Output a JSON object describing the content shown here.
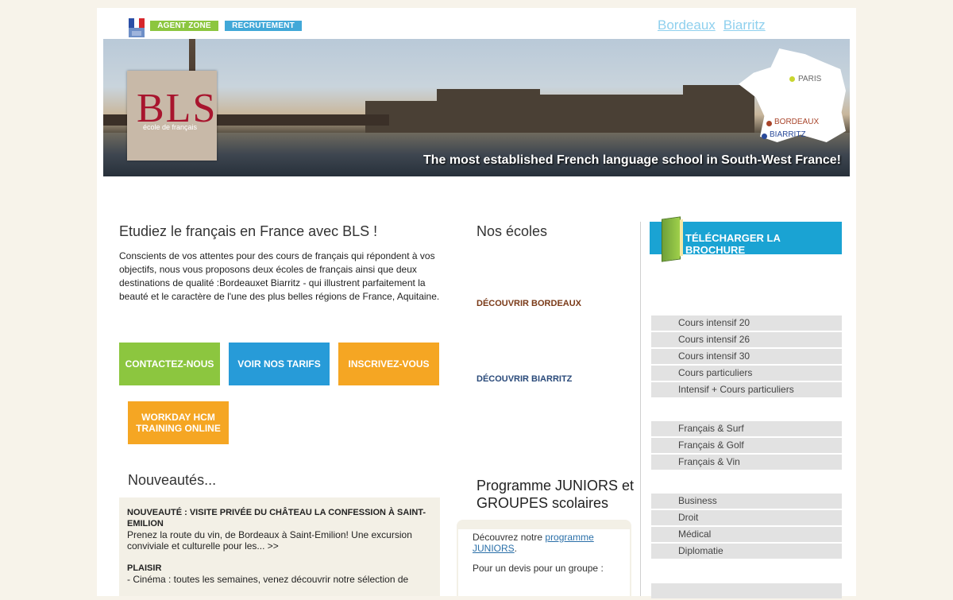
{
  "topbar": {
    "agent_zone": "AGENT ZONE",
    "recrutement": "RECRUTEMENT",
    "city_links": [
      "Bordeaux",
      "Biarritz"
    ]
  },
  "banner": {
    "logo_mark": "BLS",
    "logo_sub": "école de français",
    "map_cities": [
      "PARIS",
      "BORDEAUX",
      "BIARRITZ"
    ],
    "tagline": "The most established French language school in South-West France!"
  },
  "intro": {
    "title": "Etudiez le français en France avec BLS !",
    "text": "Conscients de vos attentes pour des cours de français qui répondent à vos objectifs, nous vous proposons deux écoles de français ainsi que deux destinations de qualité :Bordeauxet Biarritz - qui illustrent parfaitement la beauté et le caractère de l'une des plus belles régions de France, Aquitaine."
  },
  "cta": {
    "contact": "CONTACTEZ-NOUS",
    "tarifs": "VOIR NOS TARIFS",
    "inscrivez": "INSCRIVEZ-VOUS",
    "workday": "WORKDAY HCM TRAINING ONLINE"
  },
  "news": {
    "heading": "Nouveautés...",
    "item_title": "NOUVEAUTÉ : VISITE PRIVÉE DU CHÂTEAU LA CONFESSION À SAINT-EMILION",
    "item_text": "Prenez la route du vin, de Bordeaux à Saint-Emilion! Une excursion conviviale et culturelle pour les... >>",
    "plaisir_title": "PLAISIR",
    "plaisir_text": "- Cinéma : toutes les semaines, venez découvrir notre sélection de"
  },
  "schools": {
    "heading": "Nos écoles",
    "bordeaux": "DÉCOUVRIR BORDEAUX",
    "biarritz": "DÉCOUVRIR BIARRITZ"
  },
  "juniors": {
    "heading": "Programme JUNIORS et GROUPES scolaires",
    "text_before": "Découvrez notre ",
    "link": "programme JUNIORS",
    "text_after": ".",
    "devis": "Pour un devis pour un groupe :"
  },
  "brochure": {
    "label": "TÉLÉCHARGER LA BROCHURE"
  },
  "menus": {
    "courses": [
      "Cours intensif 20",
      "Cours intensif 26",
      "Cours intensif 30",
      "Cours particuliers",
      "Intensif + Cours particuliers"
    ],
    "activities": [
      "Français & Surf",
      "Français & Golf",
      "Français & Vin"
    ],
    "pro": [
      "Business",
      "Droit",
      "Médical",
      "Diplomatie"
    ]
  },
  "colors": {
    "green": "#8cc63f",
    "blue": "#279bd8",
    "orange": "#f5a623",
    "brand_red": "#a8152e"
  }
}
